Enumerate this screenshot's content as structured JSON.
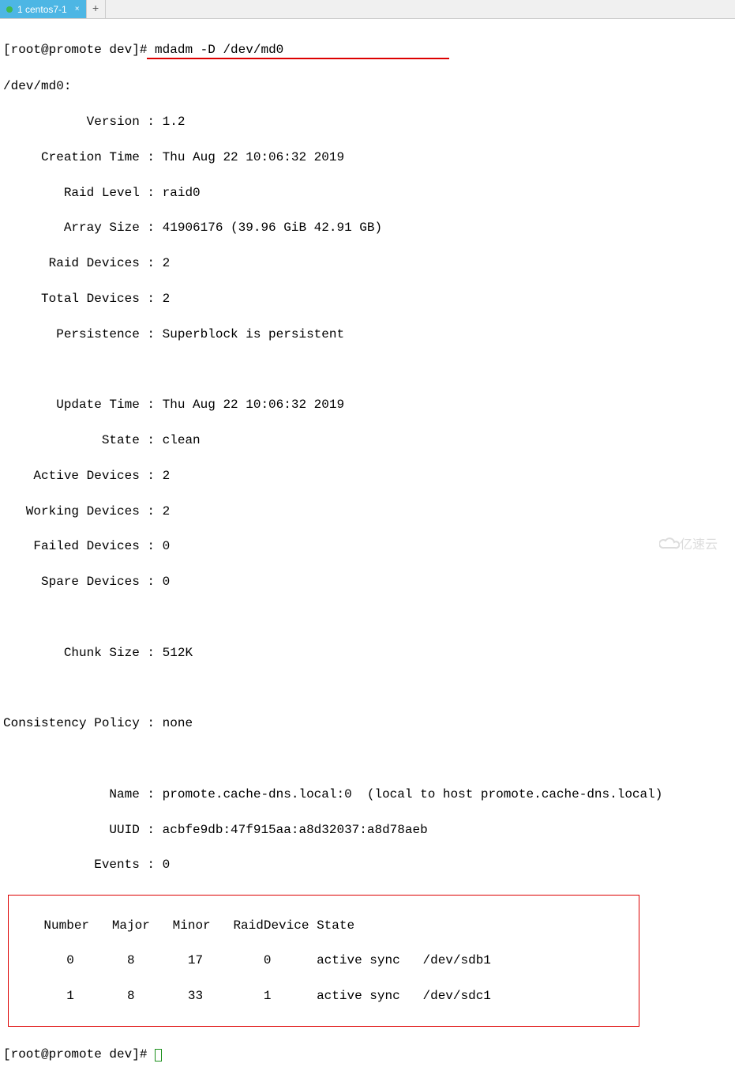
{
  "tabs": {
    "active_indicator": "●",
    "active_label": "1 centos7-1",
    "close_glyph": "×",
    "add_glyph": "+"
  },
  "prompt1": "[root@promote dev]#",
  "command": " mdadm -D /dev/md0",
  "device_line": "/dev/md0:",
  "fields": {
    "version": "           Version : 1.2",
    "creation_time": "     Creation Time : Thu Aug 22 10:06:32 2019",
    "raid_level": "        Raid Level : raid0",
    "array_size": "        Array Size : 41906176 (39.96 GiB 42.91 GB)",
    "raid_devices": "      Raid Devices : 2",
    "total_devices": "     Total Devices : 2",
    "persistence": "       Persistence : Superblock is persistent",
    "update_time": "       Update Time : Thu Aug 22 10:06:32 2019",
    "state": "             State : clean",
    "active_devices": "    Active Devices : 2",
    "working_devices": "   Working Devices : 2",
    "failed_devices": "    Failed Devices : 0",
    "spare_devices": "     Spare Devices : 0",
    "chunk_size": "        Chunk Size : 512K",
    "consistency": "Consistency Policy : none",
    "name": "              Name : promote.cache-dns.local:0  (local to host promote.cache-dns.local)",
    "uuid": "              UUID : acbfe9db:47f915aa:a8d32037:a8d78aeb",
    "events": "            Events : 0"
  },
  "device_table": {
    "header": "    Number   Major   Minor   RaidDevice State",
    "row0": "       0       8       17        0      active sync   /dev/sdb1",
    "row1": "       1       8       33        1      active sync   /dev/sdc1"
  },
  "prompt2": "[root@promote dev]# ",
  "watermark_text": "亿速云"
}
